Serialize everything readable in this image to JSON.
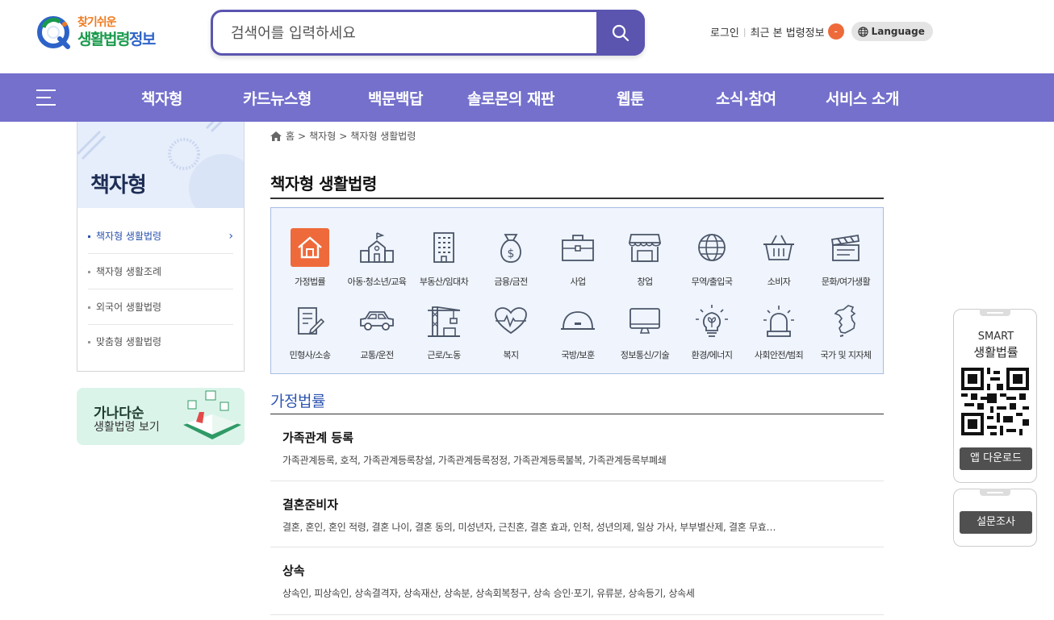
{
  "header": {
    "logo_top": "찾기쉬운",
    "logo_main_1": "생활법령",
    "logo_main_2": "정보",
    "search_placeholder": "검색어를 입력하세요",
    "login": "로그인",
    "recent": "최근 본 법령정보",
    "recent_count": "-",
    "language": "Language"
  },
  "nav": {
    "items": [
      "책자형",
      "카드뉴스형",
      "백문백답",
      "솔로몬의 재판",
      "웹툰",
      "소식·참여",
      "서비스 소개"
    ]
  },
  "sidebar": {
    "title": "책자형",
    "items": [
      {
        "label": "책자형 생활법령",
        "active": true
      },
      {
        "label": "책자형 생활조례",
        "active": false
      },
      {
        "label": "외국어 생활법령",
        "active": false
      },
      {
        "label": "맞춤형 생활법령",
        "active": false
      }
    ],
    "banner_line1": "가나다순",
    "banner_line2": "생활법령 보기"
  },
  "breadcrumb": [
    "홈",
    ">",
    "책자형",
    ">",
    "책자형 생활법령"
  ],
  "page_title": "책자형 생활법령",
  "categories": [
    {
      "label": "가정법률",
      "icon": "house-icon",
      "selected": true
    },
    {
      "label": "아동·청소년/교육",
      "icon": "school-icon"
    },
    {
      "label": "부동산/임대차",
      "icon": "building-icon"
    },
    {
      "label": "금융/금전",
      "icon": "money-bag-icon"
    },
    {
      "label": "사업",
      "icon": "briefcase-icon"
    },
    {
      "label": "창업",
      "icon": "store-icon"
    },
    {
      "label": "무역/출입국",
      "icon": "globe-icon"
    },
    {
      "label": "소비자",
      "icon": "basket-icon"
    },
    {
      "label": "문화/여가생활",
      "icon": "clapperboard-icon"
    },
    {
      "label": "민형사/소송",
      "icon": "document-pen-icon"
    },
    {
      "label": "교통/운전",
      "icon": "car-icon"
    },
    {
      "label": "근로/노동",
      "icon": "crane-icon"
    },
    {
      "label": "복지",
      "icon": "heart-pulse-icon"
    },
    {
      "label": "국방/보훈",
      "icon": "helmet-icon"
    },
    {
      "label": "정보통신/기술",
      "icon": "monitor-icon"
    },
    {
      "label": "환경/에너지",
      "icon": "lightbulb-icon"
    },
    {
      "label": "사회안전/범죄",
      "icon": "alarm-light-icon"
    },
    {
      "label": "국가 및 지자체",
      "icon": "korea-map-icon"
    }
  ],
  "section_title": "가정법률",
  "laws": [
    {
      "title": "가족관계 등록",
      "desc": "가족관계등록, 호적, 가족관계등록창설, 가족관계등록정정, 가족관계등록불복, 가족관계등록부폐쇄"
    },
    {
      "title": "결혼준비자",
      "desc": "결혼, 혼인, 혼인 적령, 결혼 나이, 결혼 동의, 미성년자, 근친혼, 결혼 효과, 인척, 성년의제, 일상 가사, 부부별산제, 결혼 무효…"
    },
    {
      "title": "상속",
      "desc": "상속인, 피상속인, 상속결격자, 상속재산, 상속분, 상속회복청구, 상속 승인·포기, 유류분, 상속등기, 상속세"
    }
  ],
  "widgets": {
    "smart_1": "SMART",
    "smart_2": "생활법률",
    "app_download": "앱 다운로드",
    "survey": "설문조사"
  },
  "colors": {
    "nav_bg": "#7470cc",
    "search_accent": "#5b55b0",
    "selected_category": "#ee6a3b",
    "link_blue": "#2f56b0"
  }
}
